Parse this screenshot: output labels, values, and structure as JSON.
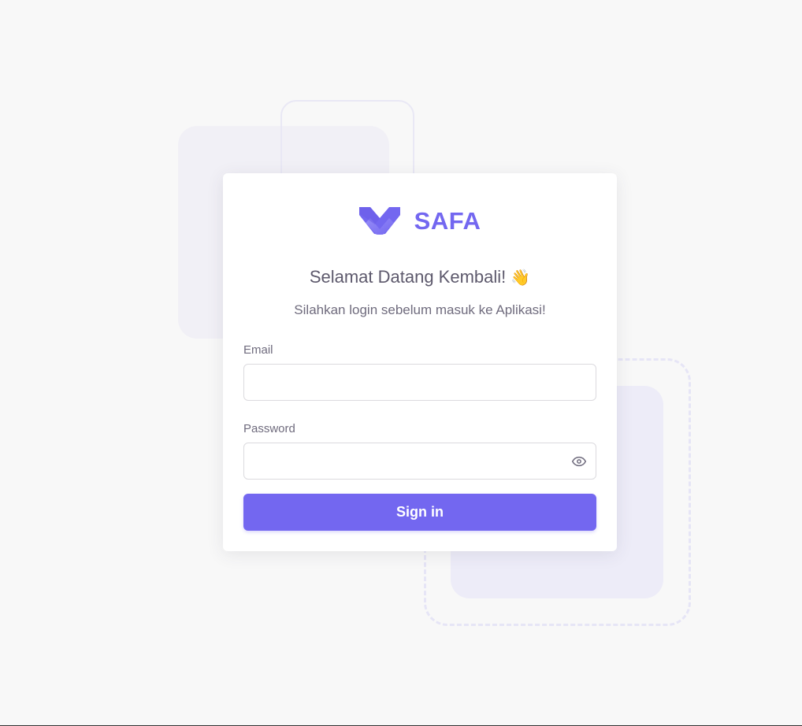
{
  "brand": {
    "name": "SAFA",
    "logo_icon": "safa-v-logo-icon",
    "color": "#7367f0"
  },
  "welcome": {
    "title": "Selamat Datang Kembali!",
    "wave_emoji": "👋",
    "subtitle": "Silahkan login sebelum masuk ke Aplikasi!"
  },
  "form": {
    "email": {
      "label": "Email",
      "value": "",
      "placeholder": ""
    },
    "password": {
      "label": "Password",
      "value": "",
      "placeholder": "",
      "toggle_icon": "eye-icon"
    },
    "submit_label": "Sign in"
  },
  "colors": {
    "accent": "#7367f0",
    "text_heading": "#5d596c",
    "text_body": "#6f6b7d",
    "background": "#f8f8f8",
    "card": "#ffffff"
  }
}
